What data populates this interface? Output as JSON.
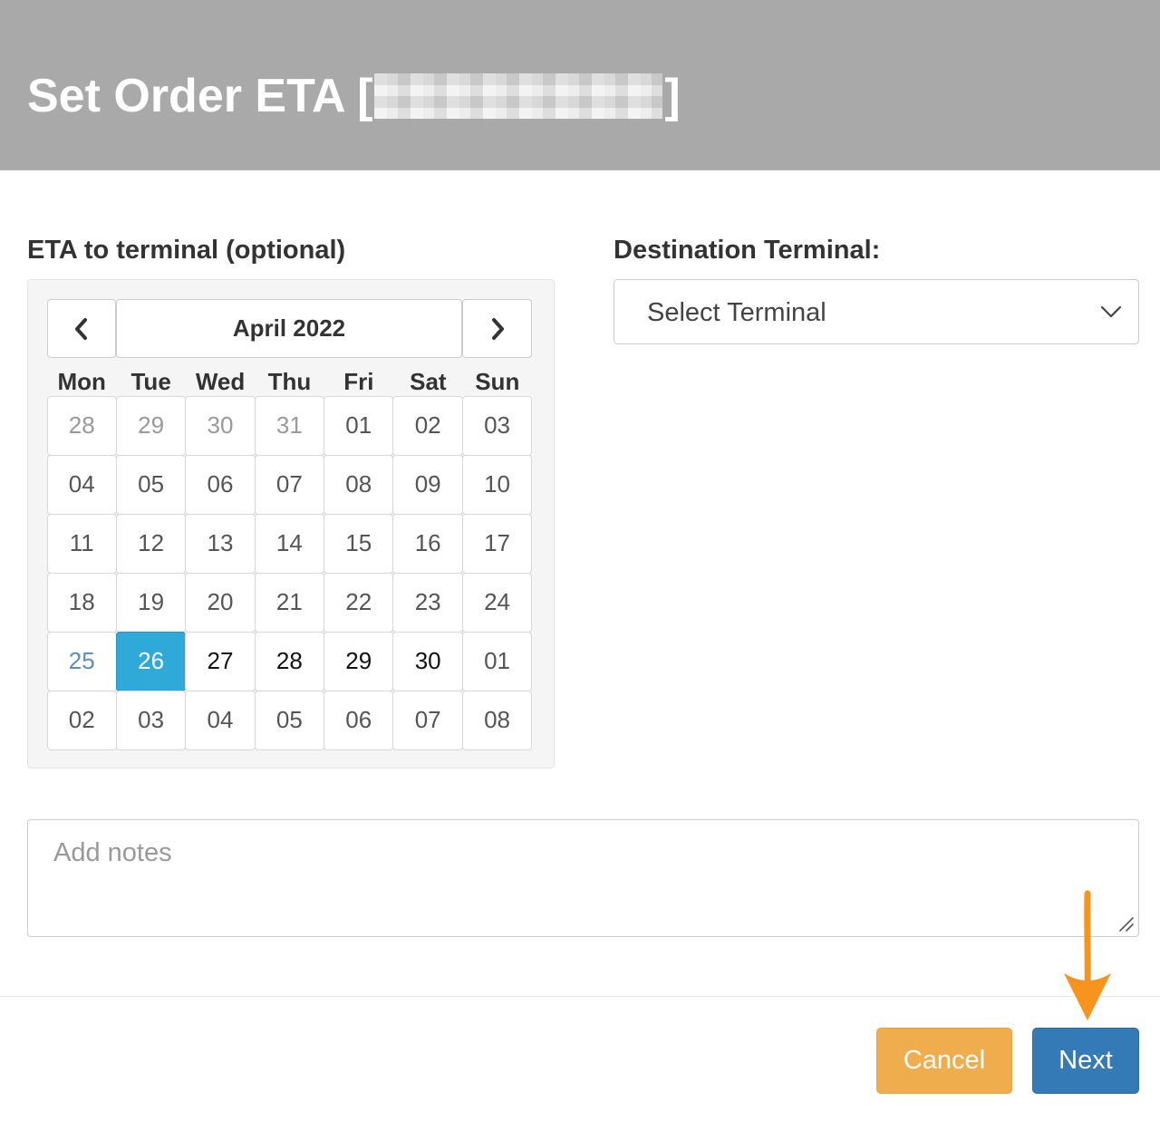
{
  "header": {
    "title_prefix": "Set Order ETA [",
    "title_suffix": "]"
  },
  "eta": {
    "label": "ETA to terminal (optional)",
    "month_title": "April 2022",
    "weekdays": [
      "Mon",
      "Tue",
      "Wed",
      "Thu",
      "Fri",
      "Sat",
      "Sun"
    ],
    "days": [
      {
        "label": "28",
        "state": "muted"
      },
      {
        "label": "29",
        "state": "muted"
      },
      {
        "label": "30",
        "state": "muted"
      },
      {
        "label": "31",
        "state": "muted"
      },
      {
        "label": "01",
        "state": "past"
      },
      {
        "label": "02",
        "state": "past"
      },
      {
        "label": "03",
        "state": "past"
      },
      {
        "label": "04",
        "state": "past"
      },
      {
        "label": "05",
        "state": "past"
      },
      {
        "label": "06",
        "state": "past"
      },
      {
        "label": "07",
        "state": "past"
      },
      {
        "label": "08",
        "state": "past"
      },
      {
        "label": "09",
        "state": "past"
      },
      {
        "label": "10",
        "state": "past"
      },
      {
        "label": "11",
        "state": "past"
      },
      {
        "label": "12",
        "state": "past"
      },
      {
        "label": "13",
        "state": "past"
      },
      {
        "label": "14",
        "state": "past"
      },
      {
        "label": "15",
        "state": "past"
      },
      {
        "label": "16",
        "state": "past"
      },
      {
        "label": "17",
        "state": "past"
      },
      {
        "label": "18",
        "state": "past"
      },
      {
        "label": "19",
        "state": "past"
      },
      {
        "label": "20",
        "state": "past"
      },
      {
        "label": "21",
        "state": "past"
      },
      {
        "label": "22",
        "state": "past"
      },
      {
        "label": "23",
        "state": "past"
      },
      {
        "label": "24",
        "state": "past"
      },
      {
        "label": "25",
        "state": "today"
      },
      {
        "label": "26",
        "state": "selected"
      },
      {
        "label": "27",
        "state": "active"
      },
      {
        "label": "28",
        "state": "active"
      },
      {
        "label": "29",
        "state": "active"
      },
      {
        "label": "30",
        "state": "active"
      },
      {
        "label": "01",
        "state": "past"
      },
      {
        "label": "02",
        "state": "past"
      },
      {
        "label": "03",
        "state": "past"
      },
      {
        "label": "04",
        "state": "past"
      },
      {
        "label": "05",
        "state": "past"
      },
      {
        "label": "06",
        "state": "past"
      },
      {
        "label": "07",
        "state": "past"
      },
      {
        "label": "08",
        "state": "past"
      }
    ]
  },
  "destination": {
    "label": "Destination Terminal:",
    "select_value": "Select Terminal"
  },
  "notes": {
    "placeholder": "Add notes"
  },
  "footer": {
    "cancel_label": "Cancel",
    "next_label": "Next"
  },
  "colors": {
    "header_bg": "#a9a9a9",
    "selected_day": "#2faad8",
    "cancel_button": "#f0ad4e",
    "next_button": "#337ab7",
    "annotation_arrow": "#f7941d"
  },
  "icons": {
    "prev": "chevron-left-icon",
    "next": "chevron-right-icon",
    "select_caret": "chevron-down-icon",
    "resize": "resize-handle-icon",
    "annotation": "arrow-down-icon"
  }
}
